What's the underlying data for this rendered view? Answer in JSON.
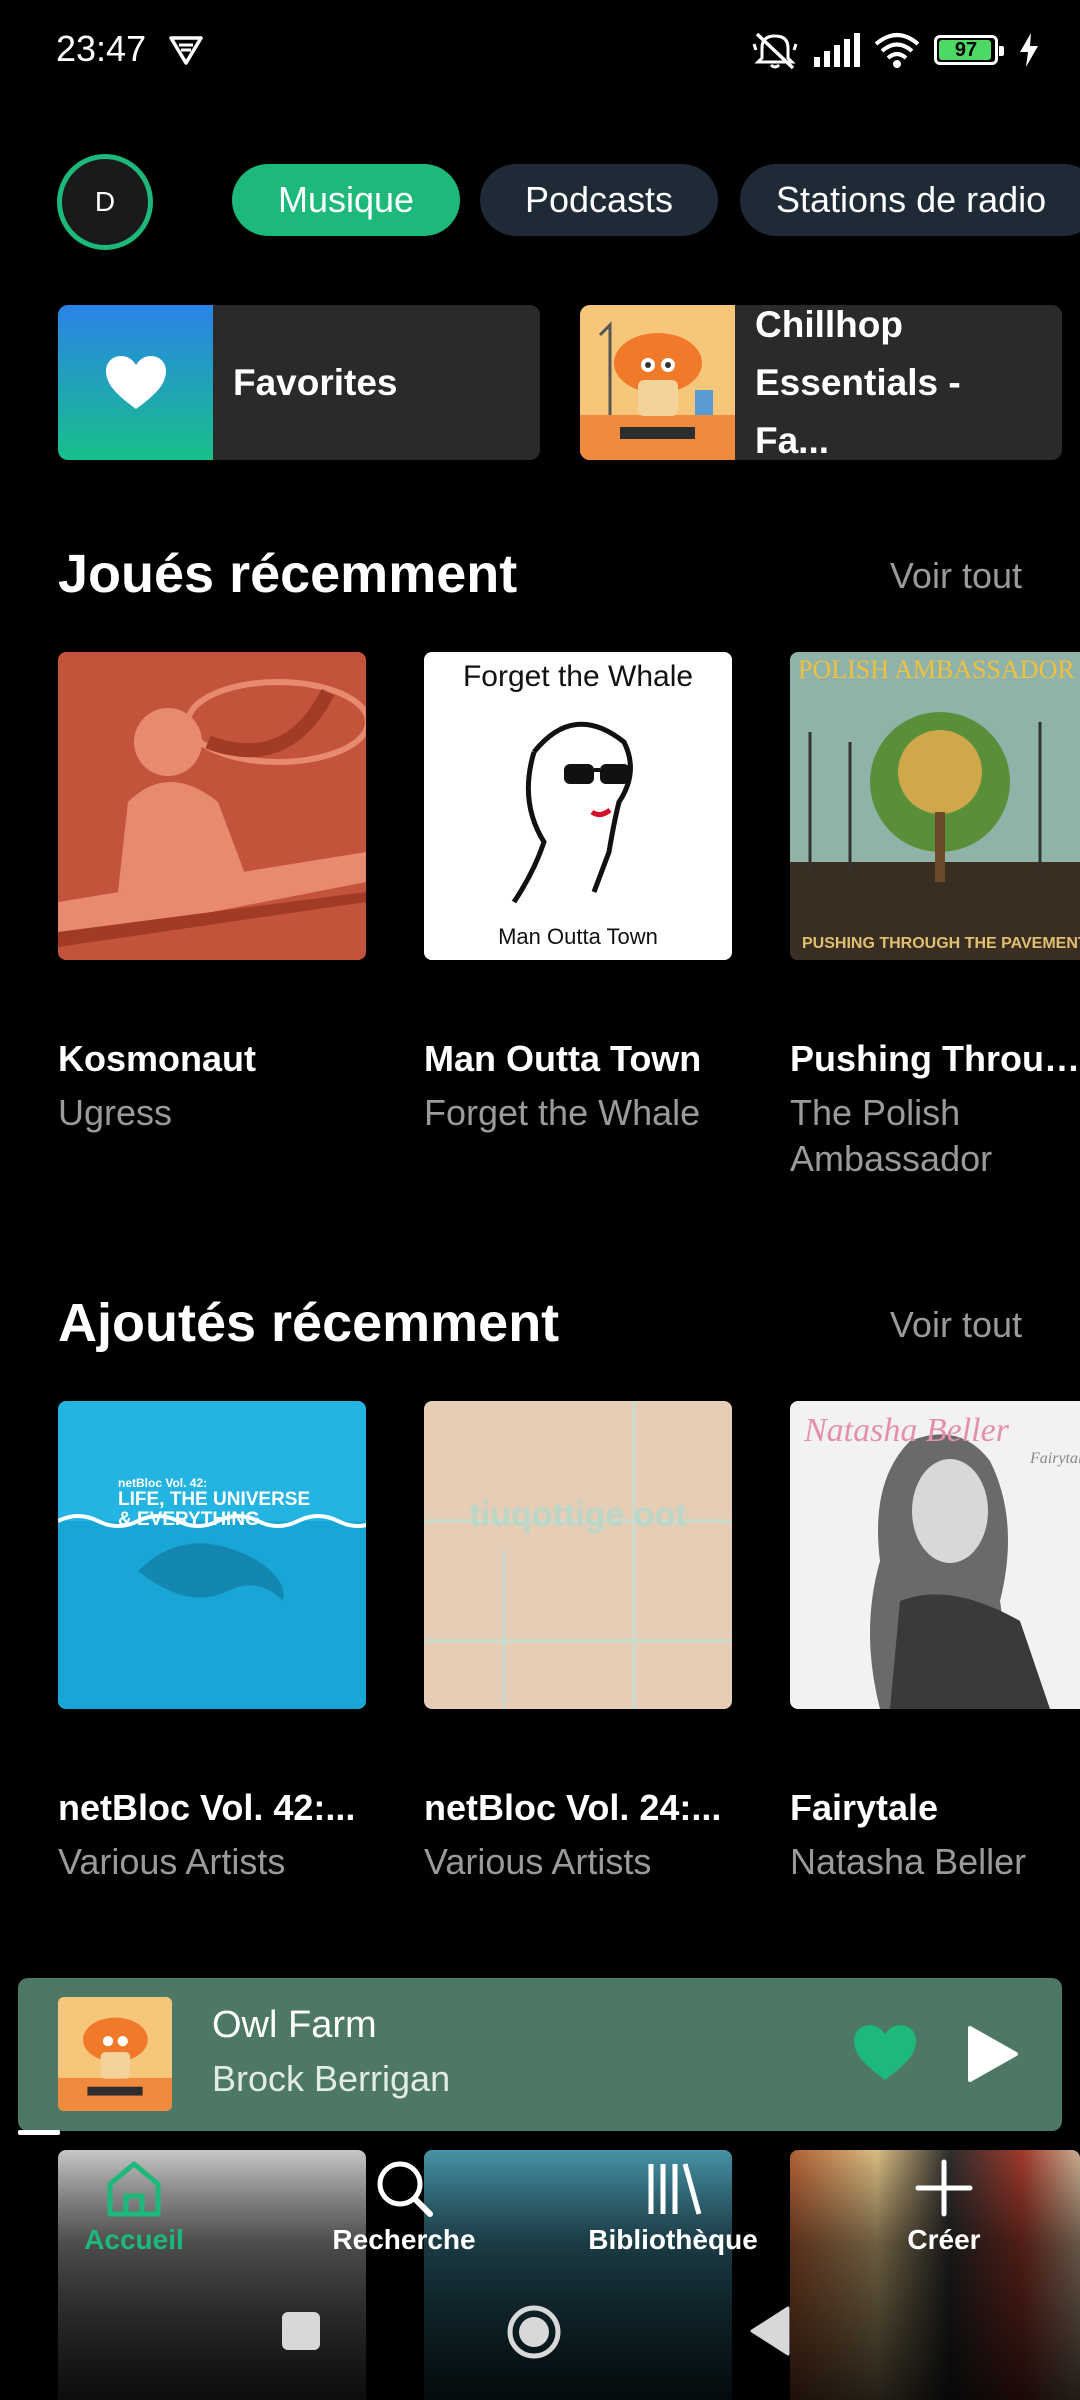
{
  "status_bar": {
    "time": "23:47",
    "battery_level": "97",
    "battery_fraction": 0.97,
    "icons": [
      "vpn-icon",
      "mute-icon",
      "signal-icon",
      "wifi-icon",
      "battery-icon",
      "charging-icon"
    ]
  },
  "profile": {
    "avatar_letter": "D"
  },
  "filters": [
    {
      "label": "Musique",
      "active": true
    },
    {
      "label": "Podcasts",
      "active": false
    },
    {
      "label": "Stations de radio",
      "active": false
    }
  ],
  "pinned": [
    {
      "title": "Favorites",
      "icon": "heart-icon"
    },
    {
      "title_line1": "Chillhop",
      "title_line2": "Essentials - Fa..."
    }
  ],
  "recently_played": {
    "title": "Joués récemment",
    "see_all": "Voir tout",
    "items": [
      {
        "title": "Kosmonaut",
        "subtitle": "Ugress"
      },
      {
        "title": "Man Outta Town",
        "subtitle": "Forget the Whale",
        "cover_text_top": "Forget the Whale",
        "cover_text_bottom": "Man Outta Town"
      },
      {
        "title": "Pushing Throug...",
        "subtitle_line1": "The Polish",
        "subtitle_line2": "Ambassador",
        "cover_text_top": "POLISH AMBASSADOR",
        "cover_text_bottom": "PUSHING THROUGH THE PAVEMENT"
      }
    ]
  },
  "recently_added": {
    "title": "Ajoutés récemment",
    "see_all": "Voir tout",
    "items": [
      {
        "title": "netBloc Vol. 42:...",
        "subtitle": "Various Artists",
        "cover_text_top": "netBloc Vol. 42:",
        "cover_text_line1": "LIFE, THE UNIVERSE",
        "cover_text_line2": "& EVERYTHING"
      },
      {
        "title": "netBloc Vol. 24:...",
        "subtitle": "Various Artists",
        "cover_text": "tiuqottige oot"
      },
      {
        "title": "Fairytale",
        "subtitle": "Natasha Beller",
        "cover_text": "Natasha Beller",
        "cover_text_sub": "Fairytale"
      }
    ]
  },
  "mini_player": {
    "title": "Owl Farm",
    "artist": "Brock Berrigan",
    "progress": 0.04
  },
  "bottom_nav": [
    {
      "label": "Accueil",
      "icon": "home-icon",
      "active": true
    },
    {
      "label": "Recherche",
      "icon": "search-icon",
      "active": false
    },
    {
      "label": "Bibliothèque",
      "icon": "library-icon",
      "active": false
    },
    {
      "label": "Créer",
      "icon": "plus-icon",
      "active": false
    }
  ],
  "colors": {
    "accent": "#1db97a",
    "mini_player_bg": "#4e7866",
    "chip_inactive": "#1e2a36"
  }
}
